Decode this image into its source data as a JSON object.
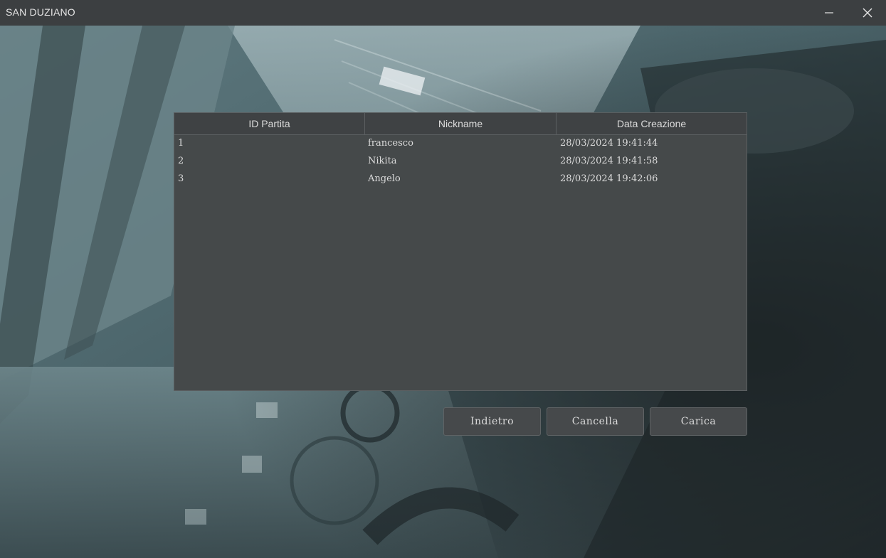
{
  "window": {
    "title": "SAN DUZIANO",
    "minimize_icon": "minimize-icon",
    "close_icon": "close-icon"
  },
  "table": {
    "columns": [
      "ID Partita",
      "Nickname",
      "Data Creazione"
    ],
    "rows": [
      {
        "id": "1",
        "nickname": "francesco",
        "date": "28/03/2024 19:41:44"
      },
      {
        "id": "2",
        "nickname": "Nikita",
        "date": "28/03/2024 19:41:58"
      },
      {
        "id": "3",
        "nickname": "Angelo",
        "date": "28/03/2024 19:42:06"
      }
    ]
  },
  "buttons": {
    "back": "Indietro",
    "delete": "Cancella",
    "load": "Carica"
  },
  "colors": {
    "titlebar": "#3c3f41",
    "panel": "#45494a",
    "text": "#dcdcdc"
  }
}
